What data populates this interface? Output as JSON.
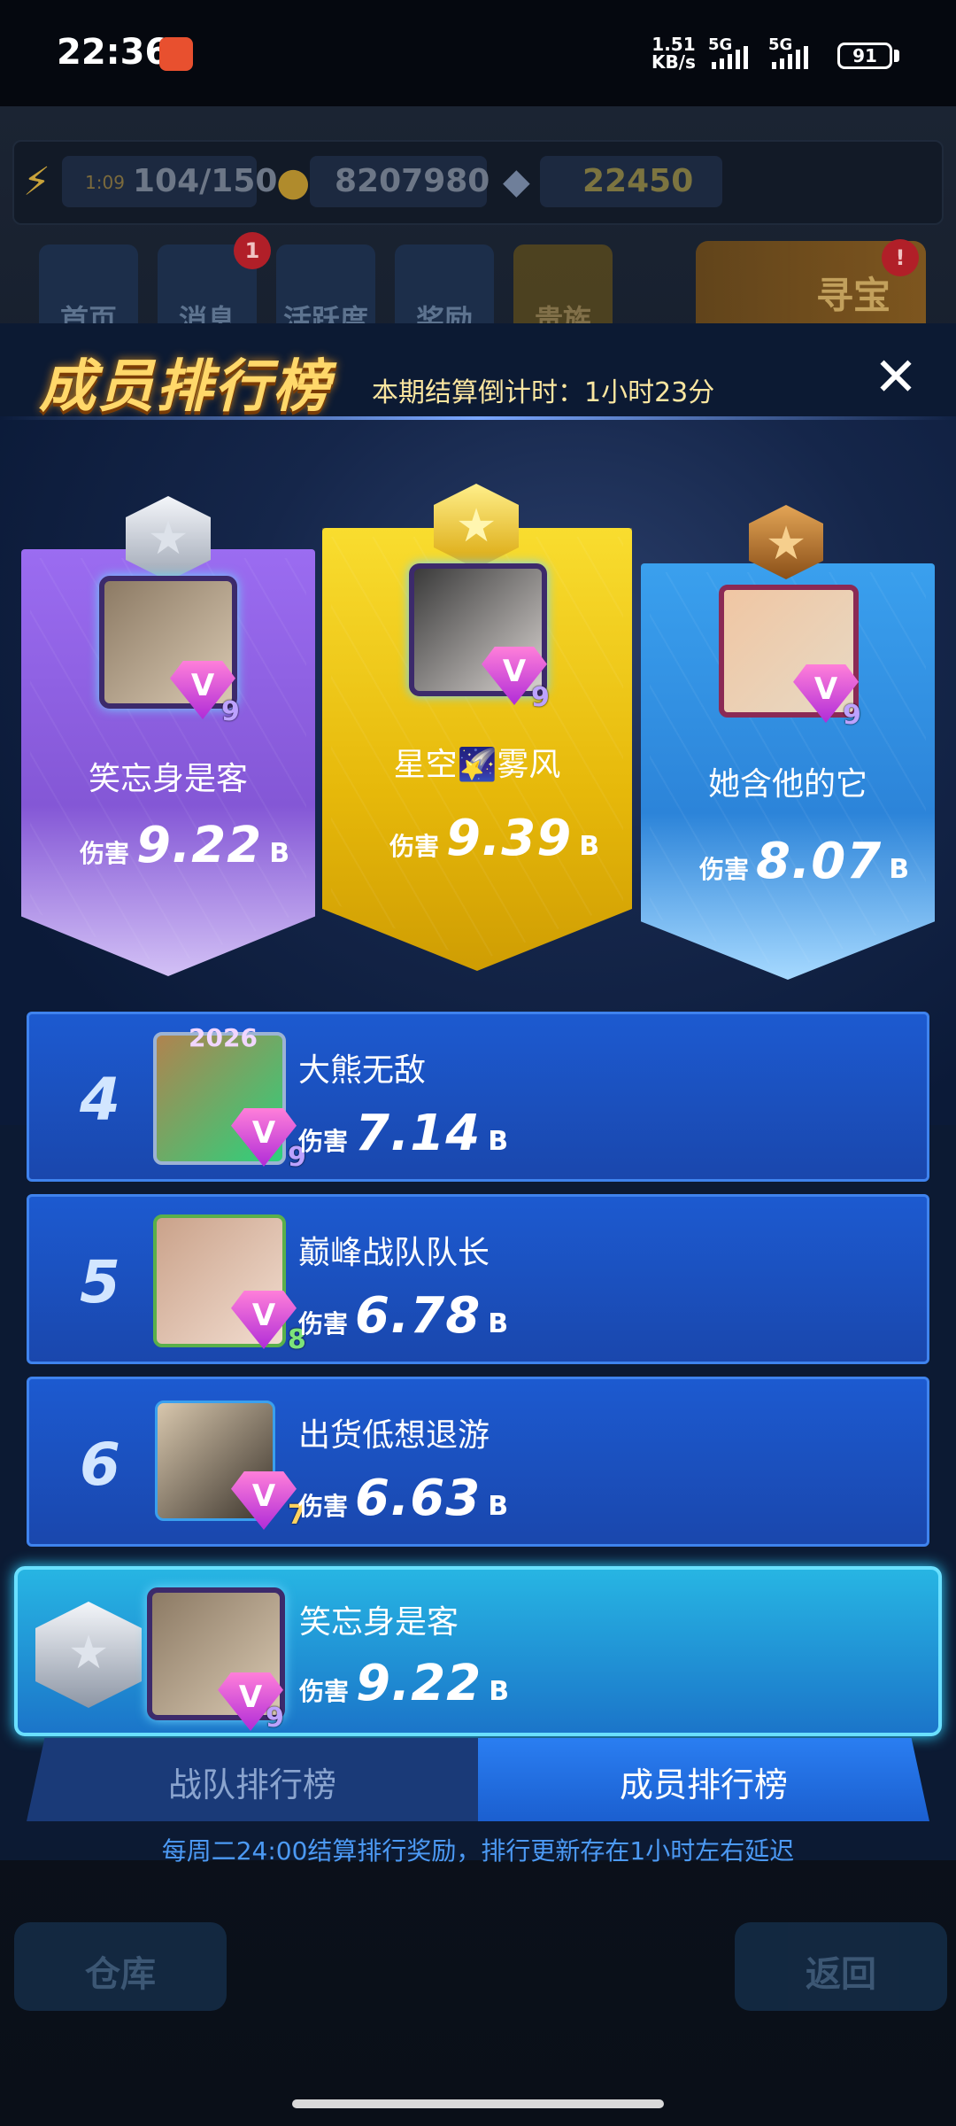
{
  "status_bar": {
    "time": "22:36",
    "net_speed_value": "1.51",
    "net_speed_unit": "KB/s",
    "sim1": "5G",
    "sim2": "5G",
    "battery": "91"
  },
  "background": {
    "timer": "1:09",
    "energy": "104/150",
    "coins": "8207980",
    "gems": "22450",
    "nav": [
      "首页",
      "消息",
      "活跃度",
      "奖励",
      "贵族"
    ],
    "message_badge": "1",
    "treasure_label": "寻宝",
    "treasure_badge": "!",
    "warehouse_label": "仓库",
    "back_label": "返回"
  },
  "panel": {
    "title": "成员排行榜",
    "countdown": "本期结算倒计时：1小时23分",
    "close_symbol": "✕"
  },
  "damage_label": "伤害",
  "damage_unit": "B",
  "podium": [
    {
      "rank": 1,
      "name": "星空🌠雾风",
      "damage": "9.39",
      "level": "9",
      "medal_color": "#f2c719"
    },
    {
      "rank": 2,
      "name": "笑忘身是客",
      "damage": "9.22",
      "level": "9",
      "medal_color": "#cfd4dc"
    },
    {
      "rank": 3,
      "name": "她含他的它",
      "damage": "8.07",
      "level": "9",
      "medal_color": "#c5812e"
    }
  ],
  "list": [
    {
      "rank": "4",
      "name": "大熊无敌",
      "damage": "7.14",
      "level": "9",
      "frame_tag": "2026"
    },
    {
      "rank": "5",
      "name": "巅峰战队队长",
      "damage": "6.78",
      "level": "8"
    },
    {
      "rank": "6",
      "name": "出货低想退游",
      "damage": "6.63",
      "level": "7"
    }
  ],
  "self": {
    "name": "笑忘身是客",
    "damage": "9.22",
    "level": "9"
  },
  "tabs": {
    "team": "战队排行榜",
    "member": "成员排行榜"
  },
  "footer_note": "每周二24:00结算排行奖励，排行更新存在1小时左右延迟",
  "colors": {
    "gold": "#f2c719",
    "purple": "#8457d6",
    "blue": "#2c84d9",
    "row_blue": "#1a47ad",
    "self_cyan": "#27b5e3"
  }
}
